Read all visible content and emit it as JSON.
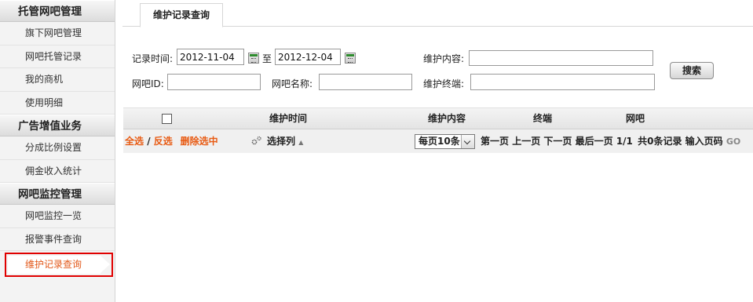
{
  "sidebar": {
    "sections": [
      {
        "title": "托管网吧管理",
        "items": [
          "旗下网吧管理",
          "网吧托管记录",
          "我的商机",
          "使用明细"
        ]
      },
      {
        "title": "广告增值业务",
        "items": [
          "分成比例设置",
          "佣金收入统计"
        ]
      },
      {
        "title": "网吧监控管理",
        "items": [
          "网吧监控一览",
          "报警事件查询"
        ]
      }
    ],
    "active_item": "维护记录查询"
  },
  "tab": {
    "label": "维护记录查询"
  },
  "form": {
    "record_time_label": "记录时间:",
    "date_from": "2012-11-04",
    "to_label": "至",
    "date_to": "2012-12-04",
    "content_label": "维护内容:",
    "content_value": "",
    "netbar_id_label": "网吧ID:",
    "netbar_id_value": "",
    "netbar_name_label": "网吧名称:",
    "netbar_name_value": "",
    "terminal_label": "维护终端:",
    "terminal_value": "",
    "search_button": "搜索"
  },
  "table": {
    "columns": [
      "维护时间",
      "维护内容",
      "终端",
      "网吧"
    ]
  },
  "toolbar": {
    "select_all": "全选",
    "separator": " / ",
    "invert": "反选",
    "delete_selected": "删除选中",
    "choose_columns": "选择列",
    "page_size": "每页10条",
    "first_page": "第一页",
    "prev_page": "上一页",
    "next_page": "下一页",
    "last_page": "最后一页",
    "page_info": "1/1",
    "total": "共0条记录",
    "enter_page": "输入页码",
    "go": "GO"
  },
  "colors": {
    "accent": "#e85a12",
    "highlight_border": "#e00000"
  }
}
